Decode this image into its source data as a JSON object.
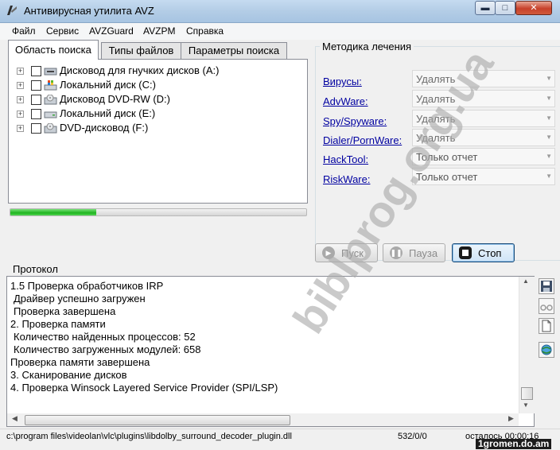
{
  "window": {
    "title": "Антивирусная утилита AVZ"
  },
  "menu": [
    "Файл",
    "Сервис",
    "AVZGuard",
    "AVZPM",
    "Справка"
  ],
  "tabs": {
    "area": "Область поиска",
    "types": "Типы файлов",
    "params": "Параметры поиска"
  },
  "tree": [
    {
      "label": "Дисковод для гнучких дисков (A:)",
      "icon": "floppy-drive-icon"
    },
    {
      "label": "Локальний диск (C:)",
      "icon": "system-disk-icon"
    },
    {
      "label": "Дисковод DVD-RW (D:)",
      "icon": "dvd-drive-icon"
    },
    {
      "label": "Локальний диск (E:)",
      "icon": "hard-disk-icon"
    },
    {
      "label": "DVD-дисковод (F:)",
      "icon": "dvd-drive-icon"
    }
  ],
  "progress": 0.29,
  "treatment": {
    "title": "Методика лечения",
    "rows": [
      {
        "label": "Вирусы:",
        "value": "Удалять"
      },
      {
        "label": "AdvWare:",
        "value": "Удалять"
      },
      {
        "label": "Spy/Spyware:",
        "value": "Удалять"
      },
      {
        "label": "Dialer/PornWare:",
        "value": "Удалять"
      },
      {
        "label": "HackTool:",
        "value": "Только отчет"
      },
      {
        "label": "RiskWare:",
        "value": "Только отчет"
      }
    ]
  },
  "buttons": {
    "start": "Пуск",
    "pause": "Пауза",
    "stop": "Стоп"
  },
  "protocol": {
    "title": "Протокол",
    "lines": [
      "1.5 Проверка обработчиков IRP",
      " Драйвер успешно загружен",
      " Проверка завершена",
      "2. Проверка памяти",
      " Количество найденных процессов: 52",
      " Количество загруженных модулей: 658",
      "Проверка памяти завершена",
      "3. Сканирование дисков",
      "4. Проверка Winsock Layered Service Provider (SPI/LSP)"
    ]
  },
  "status": {
    "path": "c:\\program files\\videolan\\vlc\\plugins\\libdolby_surround_decoder_plugin.dll",
    "count": "532/0/0",
    "remain": "осталось 00:00:16"
  },
  "watermark": "biblprog.org.ua",
  "corner_watermark": "1gromen.do.am"
}
